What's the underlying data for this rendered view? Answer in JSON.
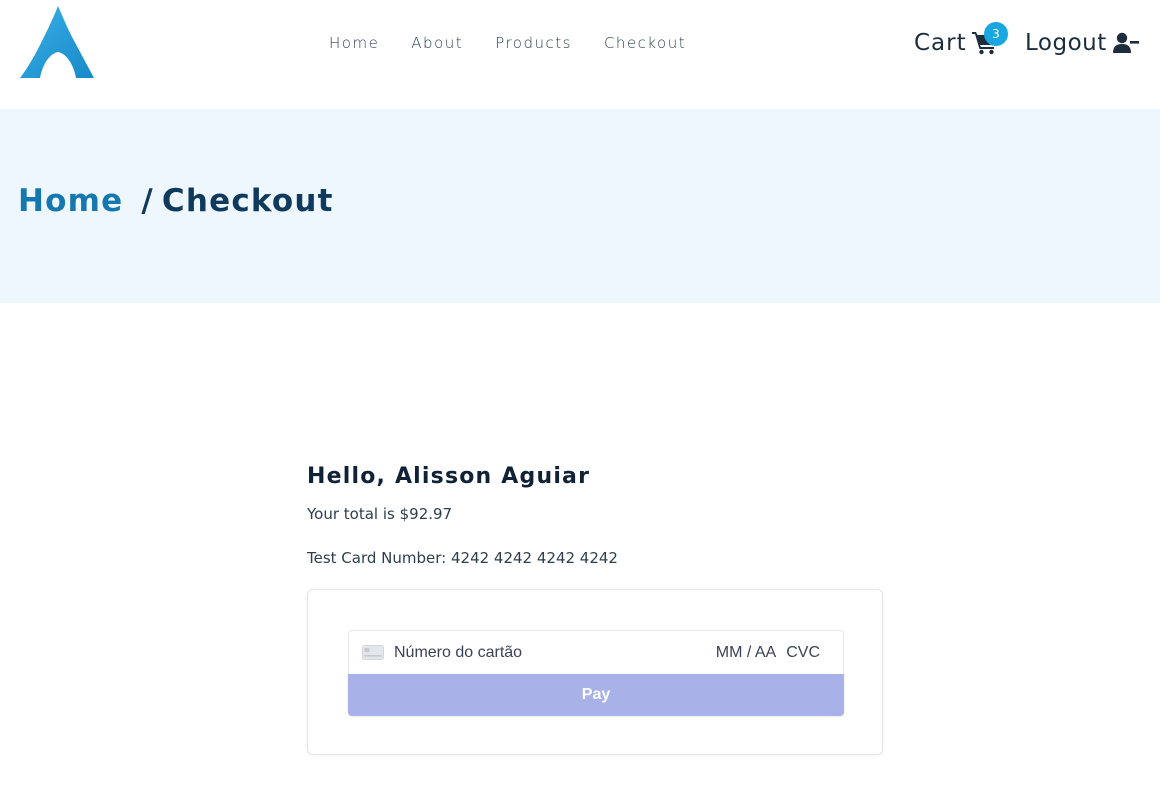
{
  "header": {
    "logo_icon": "arch-logo-icon",
    "nav": [
      "Home",
      "About",
      "Products",
      "Checkout"
    ],
    "cart_label": "Cart",
    "cart_icon": "shopping-cart-icon",
    "cart_count": "3",
    "logout_label": "Logout",
    "logout_icon": "user-minus-icon"
  },
  "breadcrumb": {
    "home": "Home",
    "separator": "/",
    "current": "Checkout"
  },
  "checkout": {
    "greeting": "Hello, Alisson Aguiar",
    "total_text": "Your total is $92.97",
    "test_card_text": "Test Card Number: 4242 4242 4242 4242"
  },
  "payment_form": {
    "card_icon": "credit-card-icon",
    "card_number_placeholder": "Número do cartão",
    "expiry_placeholder": "MM / AA",
    "cvc_placeholder": "CVC",
    "pay_label": "Pay"
  },
  "colors": {
    "brand_blue": "#1477b0",
    "dark_navy": "#0e3a5e",
    "banner_bg": "#eff7fe",
    "badge": "#1aa6e0",
    "pay_button": "#a9b2e8"
  }
}
